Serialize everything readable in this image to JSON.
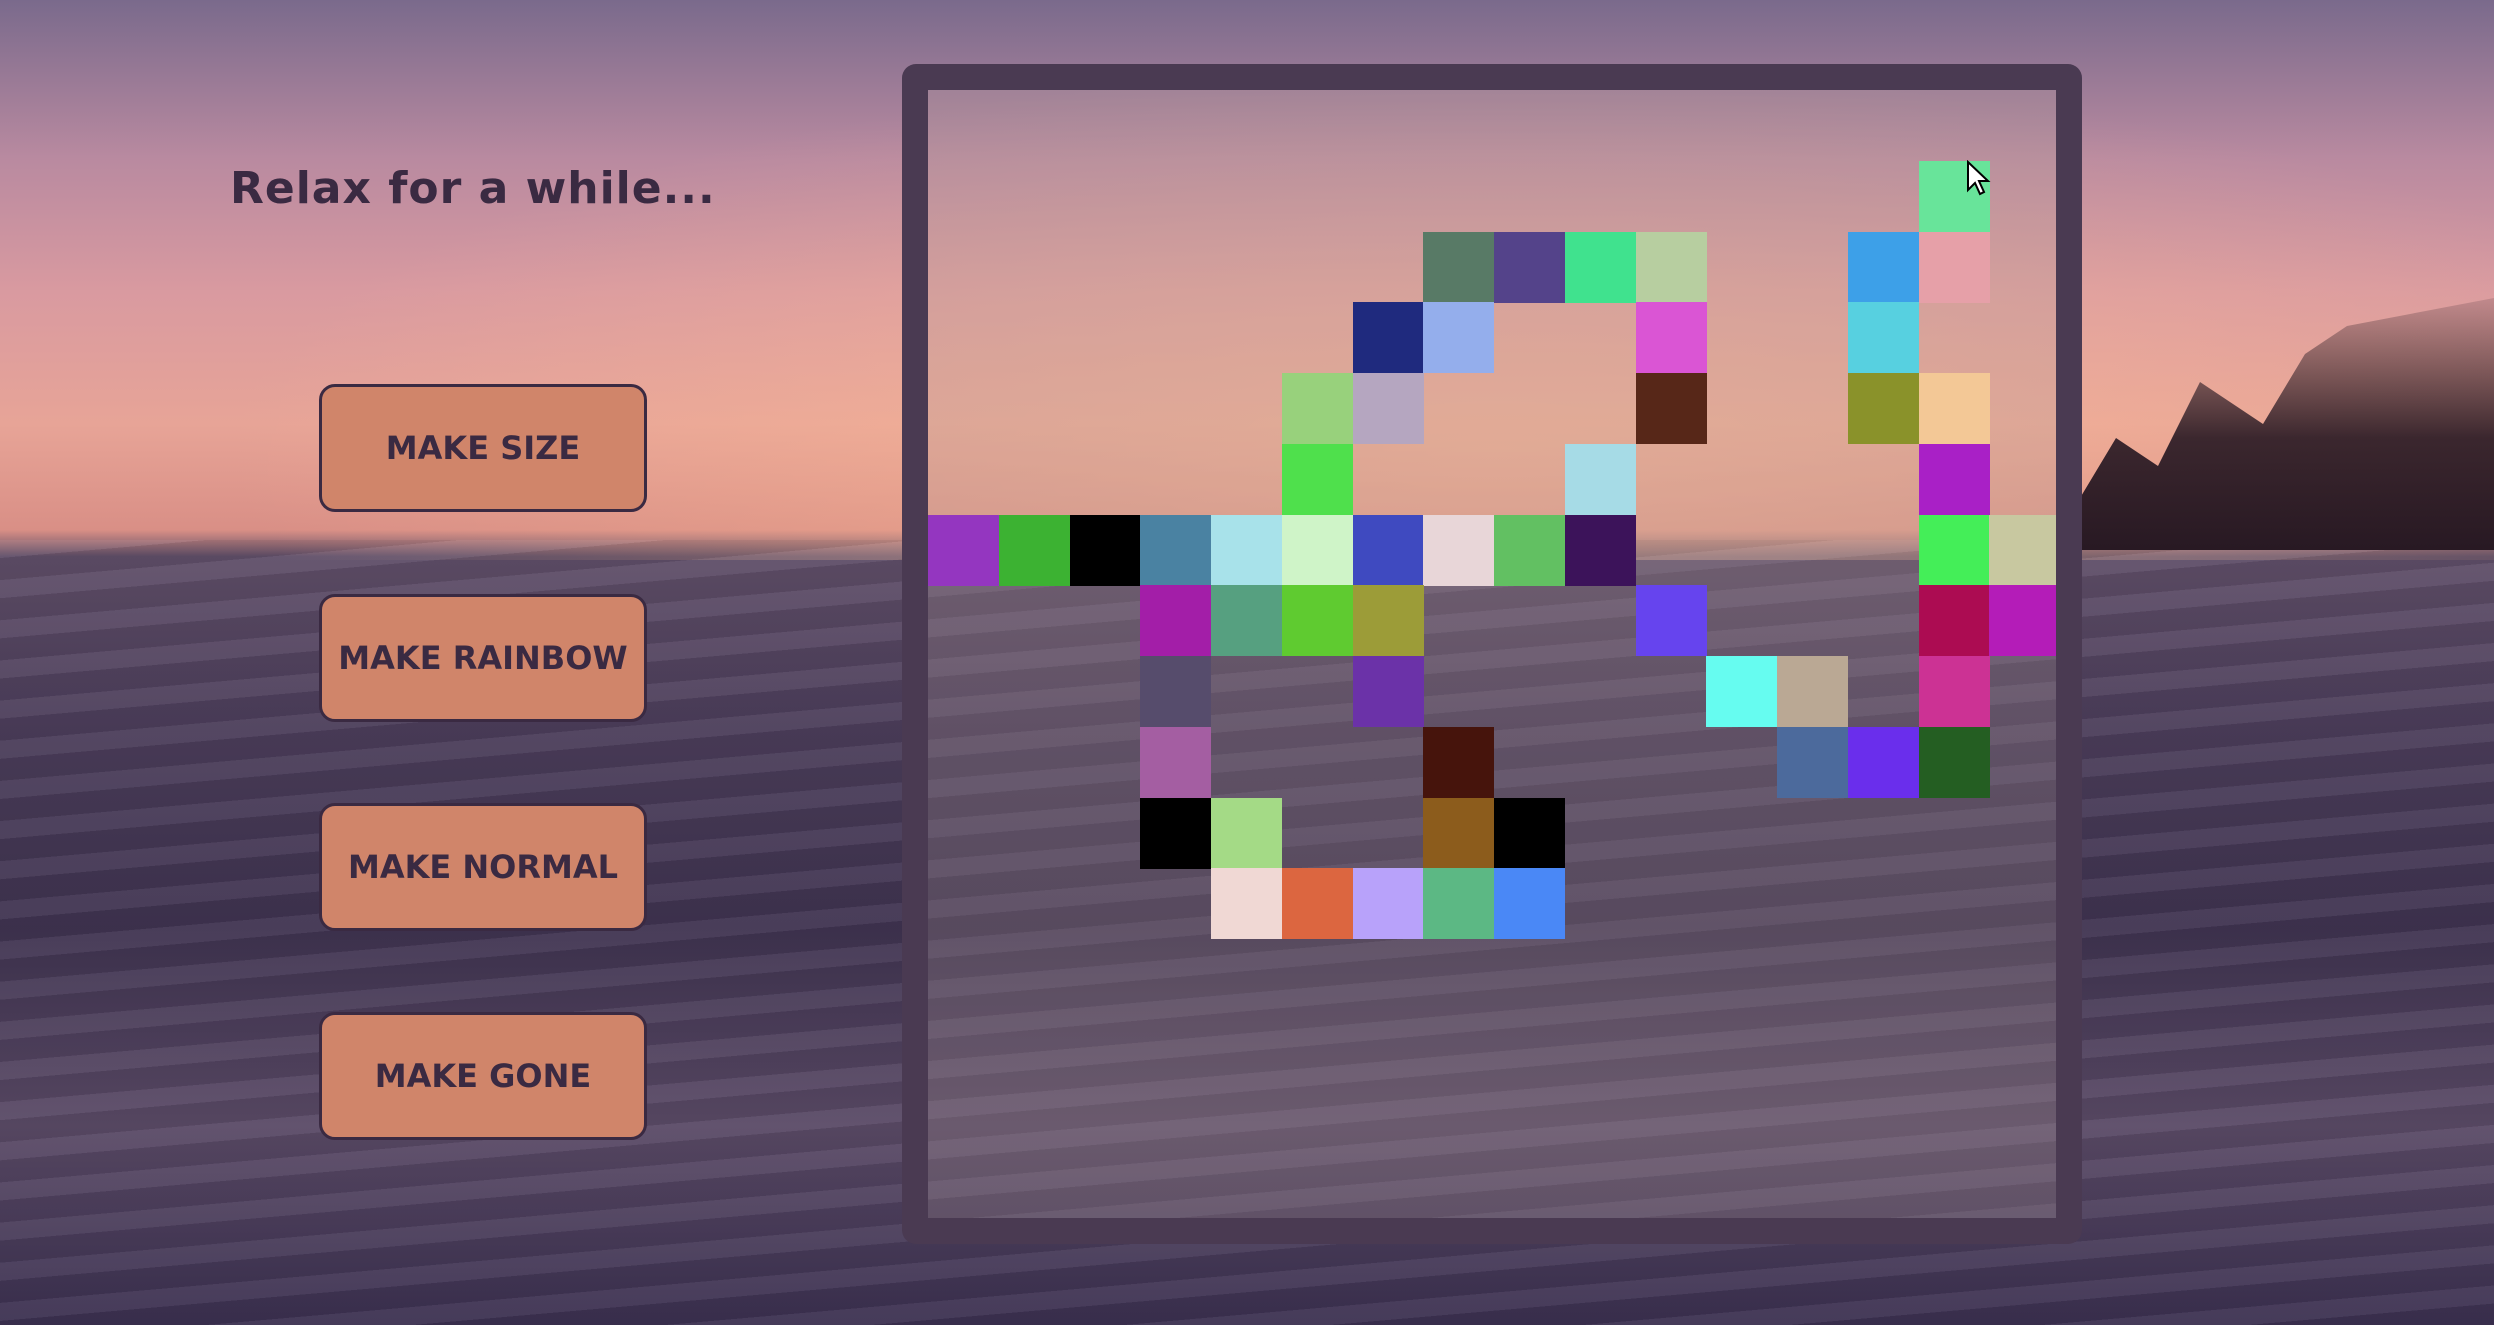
{
  "title": "Relax for a while...",
  "buttons": {
    "size": "MAKE SIZE",
    "rainbow": "MAKE RAINBOW",
    "normal": "MAKE NORMAL",
    "gone": "MAKE GONE"
  },
  "colors": {
    "button_bg": "#d0856a",
    "board_border": "#4a3a52",
    "text": "#3a2a42"
  },
  "grid": {
    "cells": [
      {
        "c": 14,
        "r": 1,
        "color": "#68e49a"
      },
      {
        "c": 7,
        "r": 2,
        "color": "#587a66"
      },
      {
        "c": 8,
        "r": 2,
        "color": "#54438a"
      },
      {
        "c": 9,
        "r": 2,
        "color": "#40e28e"
      },
      {
        "c": 10,
        "r": 2,
        "color": "#b7cea0"
      },
      {
        "c": 13,
        "r": 2,
        "color": "#3da0e8"
      },
      {
        "c": 14,
        "r": 2,
        "color": "#e6a0a8"
      },
      {
        "c": 6,
        "r": 3,
        "color": "#1f2a7e"
      },
      {
        "c": 7,
        "r": 3,
        "color": "#94aeec"
      },
      {
        "c": 10,
        "r": 3,
        "color": "#da55d4"
      },
      {
        "c": 13,
        "r": 3,
        "color": "#57d0e0"
      },
      {
        "c": 5,
        "r": 4,
        "color": "#98d17c"
      },
      {
        "c": 6,
        "r": 4,
        "color": "#b5a6c0"
      },
      {
        "c": 10,
        "r": 4,
        "color": "#572718"
      },
      {
        "c": 13,
        "r": 4,
        "color": "#8a922a"
      },
      {
        "c": 14,
        "r": 4,
        "color": "#f3c896"
      },
      {
        "c": 5,
        "r": 5,
        "color": "#4fe04c"
      },
      {
        "c": 9,
        "r": 5,
        "color": "#a6dbe6"
      },
      {
        "c": 14,
        "r": 5,
        "color": "#a920c6"
      },
      {
        "c": 0,
        "r": 6,
        "color": "#9436c0"
      },
      {
        "c": 1,
        "r": 6,
        "color": "#3cb232"
      },
      {
        "c": 2,
        "r": 6,
        "color": "#000000"
      },
      {
        "c": 3,
        "r": 6,
        "color": "#4a82a2"
      },
      {
        "c": 4,
        "r": 6,
        "color": "#a8e2ea"
      },
      {
        "c": 5,
        "r": 6,
        "color": "#cff4c8"
      },
      {
        "c": 6,
        "r": 6,
        "color": "#3f4ac0"
      },
      {
        "c": 7,
        "r": 6,
        "color": "#e8d6d8"
      },
      {
        "c": 8,
        "r": 6,
        "color": "#62c062"
      },
      {
        "c": 9,
        "r": 6,
        "color": "#3c135a"
      },
      {
        "c": 14,
        "r": 6,
        "color": "#44ee58"
      },
      {
        "c": 15,
        "r": 6,
        "color": "#c8c8a0"
      },
      {
        "c": 3,
        "r": 7,
        "color": "#a31ea8"
      },
      {
        "c": 4,
        "r": 7,
        "color": "#56a080"
      },
      {
        "c": 5,
        "r": 7,
        "color": "#5fcb30"
      },
      {
        "c": 6,
        "r": 7,
        "color": "#9c9c38"
      },
      {
        "c": 10,
        "r": 7,
        "color": "#6644ee"
      },
      {
        "c": 14,
        "r": 7,
        "color": "#ac0c52"
      },
      {
        "c": 15,
        "r": 7,
        "color": "#b41cb8"
      },
      {
        "c": 3,
        "r": 8,
        "color": "#564c6c"
      },
      {
        "c": 6,
        "r": 8,
        "color": "#6b32a8"
      },
      {
        "c": 11,
        "r": 8,
        "color": "#66fcf0"
      },
      {
        "c": 12,
        "r": 8,
        "color": "#baa894"
      },
      {
        "c": 14,
        "r": 8,
        "color": "#cc3294"
      },
      {
        "c": 3,
        "r": 9,
        "color": "#a45ea2"
      },
      {
        "c": 7,
        "r": 9,
        "color": "#46140c"
      },
      {
        "c": 12,
        "r": 9,
        "color": "#4c6a9c"
      },
      {
        "c": 13,
        "r": 9,
        "color": "#6a2eec"
      },
      {
        "c": 14,
        "r": 9,
        "color": "#245e22"
      },
      {
        "c": 3,
        "r": 10,
        "color": "#000000"
      },
      {
        "c": 4,
        "r": 10,
        "color": "#a4da86"
      },
      {
        "c": 7,
        "r": 10,
        "color": "#8c5c1c"
      },
      {
        "c": 8,
        "r": 10,
        "color": "#000000"
      },
      {
        "c": 4,
        "r": 11,
        "color": "#f0d8d4"
      },
      {
        "c": 5,
        "r": 11,
        "color": "#dc6640"
      },
      {
        "c": 6,
        "r": 11,
        "color": "#b8a2fa"
      },
      {
        "c": 7,
        "r": 11,
        "color": "#5cb884"
      },
      {
        "c": 8,
        "r": 11,
        "color": "#4a88f6"
      }
    ]
  }
}
